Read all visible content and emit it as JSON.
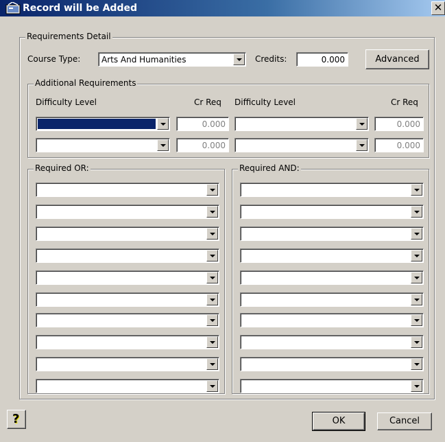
{
  "window": {
    "title": "Record will be Added",
    "close_glyph": "✕"
  },
  "requirements_detail": {
    "legend": "Requirements Detail",
    "course_type_label": "Course Type:",
    "course_type_value": "Arts  And Humanities",
    "credits_label": "Credits:",
    "credits_value": "0.000",
    "advanced_button": "Advanced"
  },
  "additional_requirements": {
    "legend": "Additional Requirements",
    "col_difficulty_left": "Difficulty Level",
    "col_crreq_left": "Cr Req",
    "col_difficulty_right": "Difficulty Level",
    "col_crreq_right": "Cr Req",
    "rows": [
      {
        "left_level": "",
        "left_cr": "0.000",
        "right_level": "",
        "right_cr": "0.000"
      },
      {
        "left_level": "",
        "left_cr": "0.000",
        "right_level": "",
        "right_cr": "0.000"
      }
    ]
  },
  "required_or": {
    "legend": "Required OR:",
    "items": [
      "",
      "",
      "",
      "",
      "",
      "",
      "",
      "",
      "",
      ""
    ]
  },
  "required_and": {
    "legend": "Required AND:",
    "items": [
      "",
      "",
      "",
      "",
      "",
      "",
      "",
      "",
      "",
      ""
    ]
  },
  "footer": {
    "help_glyph": "?",
    "ok_label": "OK",
    "cancel_label": "Cancel"
  },
  "icons": {
    "title": "app-window-icon",
    "help": "question-mark-icon",
    "close": "close-icon",
    "dropdown": "chevron-down-icon"
  },
  "colors": {
    "title_bar": "#0a246a",
    "face": "#d4d0c8",
    "selection": "#0a246a"
  }
}
